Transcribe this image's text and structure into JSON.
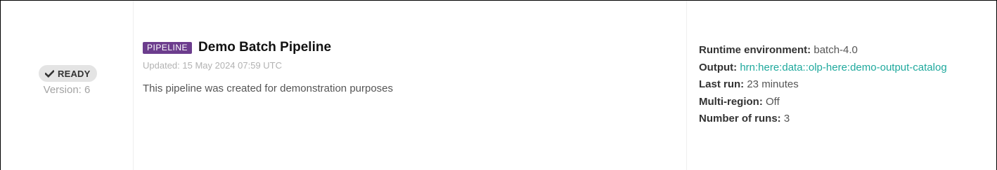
{
  "status": {
    "badge_label": "READY",
    "badge_icon": "check-icon",
    "version": "Version: 6"
  },
  "pipeline": {
    "type_tag": "PIPELINE",
    "title": "Demo Batch Pipeline",
    "updated": "Updated: 15 May 2024 07:59 UTC",
    "description": "This pipeline was created for demonstration purposes"
  },
  "meta": {
    "runtime_label": "Runtime environment:",
    "runtime_value": "batch-4.0",
    "output_label": "Output:",
    "output_value": "hrn:here:data::olp-here:demo-output-catalog",
    "last_run_label": "Last run:",
    "last_run_value": "23 minutes",
    "multi_region_label": "Multi-region:",
    "multi_region_value": "Off",
    "runs_label": "Number of runs:",
    "runs_value": "3"
  },
  "colors": {
    "tag_background": "#6c3d8d",
    "link": "#1fa99d",
    "badge_background": "#e4e4e4"
  }
}
